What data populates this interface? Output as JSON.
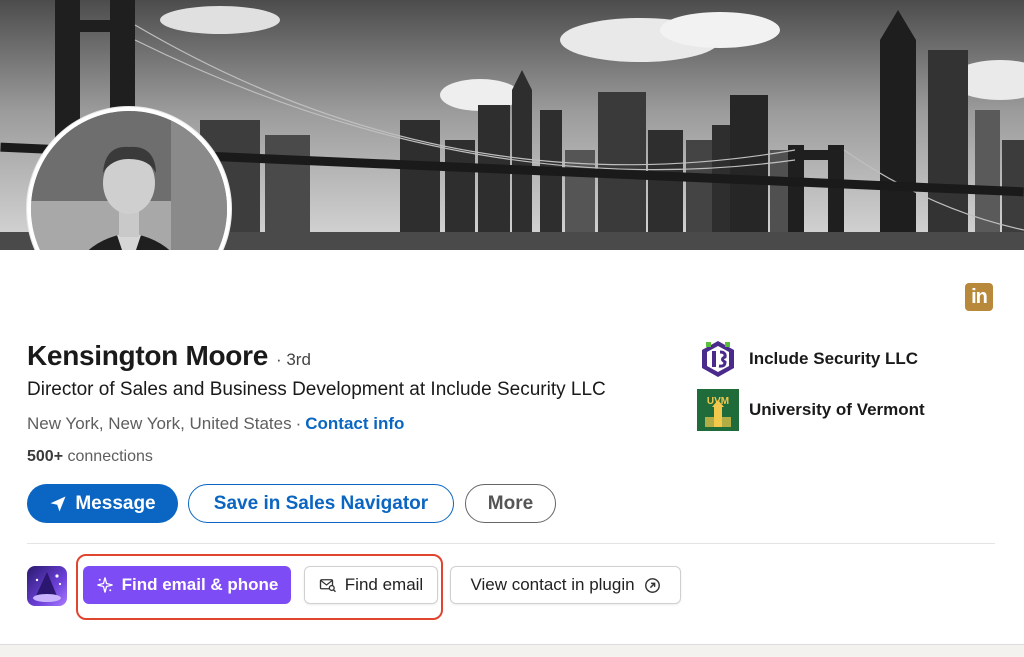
{
  "profile": {
    "name": "Kensington Moore",
    "degree": "· 3rd",
    "headline": "Director of Sales and Business Development at Include Security LLC",
    "location": "New York, New York, United States",
    "location_separator": "·",
    "contact_info_label": "Contact info",
    "connections_count": "500+",
    "connections_label": "connections"
  },
  "linkedin_badge": {
    "label": "in",
    "color": "#b8893a"
  },
  "orgs": [
    {
      "name": "Include Security LLC",
      "icon": "include-security-logo"
    },
    {
      "name": "University of Vermont",
      "icon": "uvm-logo",
      "logo_text": "UVM"
    }
  ],
  "actions": {
    "message_label": "Message",
    "save_label": "Save in Sales Navigator",
    "more_label": "More"
  },
  "plugin": {
    "find_email_phone_label": "Find email & phone",
    "find_email_label": "Find email",
    "view_contact_label": "View contact in plugin"
  },
  "colors": {
    "accent_blue": "#0a66c2",
    "plugin_purple": "#7e4cf5",
    "highlight_red": "#e0452f"
  }
}
